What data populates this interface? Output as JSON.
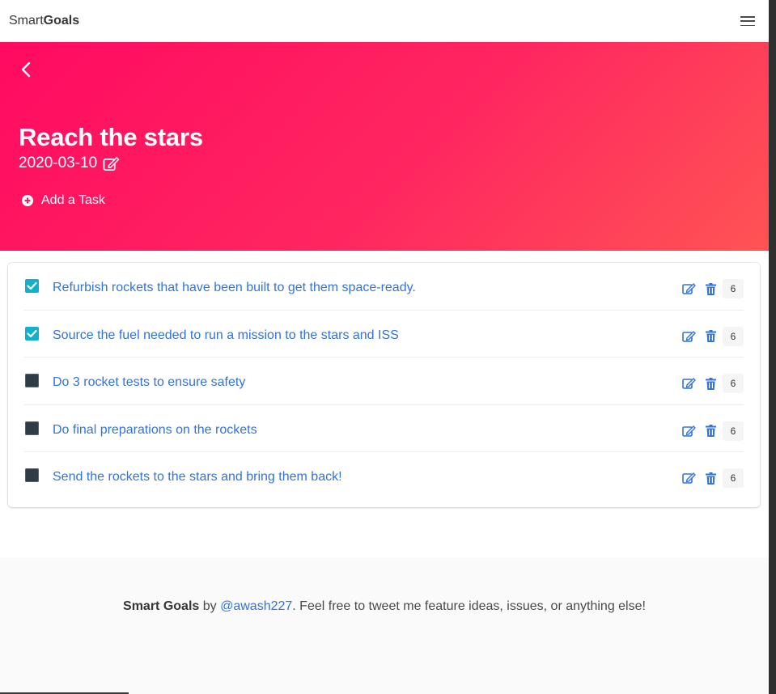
{
  "navbar": {
    "brand_light": "Smart",
    "brand_bold": "Goals"
  },
  "hero": {
    "title": "Reach the stars",
    "date": "2020-03-10",
    "add_task_label": "Add a Task"
  },
  "tasks": [
    {
      "text": "Refurbish rockets that have been built to get them space-ready.",
      "done": true,
      "count": "6"
    },
    {
      "text": "Source the fuel needed to run a mission to the stars and ISS",
      "done": true,
      "count": "6"
    },
    {
      "text": "Do 3 rocket tests to ensure safety",
      "done": false,
      "count": "6"
    },
    {
      "text": "Do final preparations on the rockets",
      "done": false,
      "count": "6"
    },
    {
      "text": "Send the rockets to the stars and bring them back!",
      "done": false,
      "count": "6"
    }
  ],
  "footer": {
    "app_name": "Smart Goals",
    "by": " by ",
    "handle": "@awash227",
    "message": ". Feel free to tweet me feature ideas, issues, or anything else!"
  },
  "colors": {
    "hero_gradient_start": "#ff0a61",
    "hero_gradient_end": "#ff5454",
    "link": "#3273dc",
    "checkbox_checked": "#10b1cf",
    "checkbox_unchecked": "#2f3b45"
  }
}
